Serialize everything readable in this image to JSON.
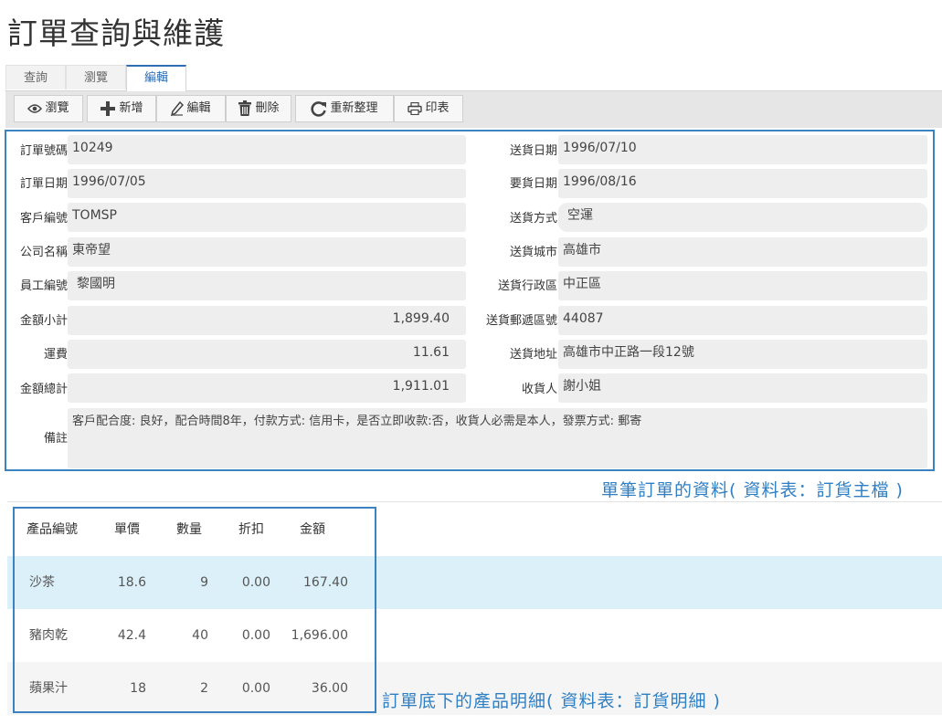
{
  "page_title": "訂單查詢與維護",
  "tabs": [
    {
      "label": "查詢"
    },
    {
      "label": "瀏覽"
    },
    {
      "label": "編輯"
    }
  ],
  "toolbar": {
    "browse": "瀏覽",
    "add": "新增",
    "edit": "編輯",
    "delete": "刪除",
    "refresh": "重新整理",
    "print": "印表"
  },
  "master": {
    "order_no": {
      "label": "訂單號碼",
      "value": "10249"
    },
    "order_date": {
      "label": "訂單日期",
      "value": "1996/07/05"
    },
    "customer_id": {
      "label": "客戶編號",
      "value": "TOMSP"
    },
    "company_name": {
      "label": "公司名稱",
      "value": "東帝望"
    },
    "employee_id": {
      "label": "員工編號",
      "value": "黎國明"
    },
    "subtotal": {
      "label": "金額小計",
      "value": "1,899.40"
    },
    "freight": {
      "label": "運費",
      "value": "11.61"
    },
    "total": {
      "label": "金額總計",
      "value": "1,911.01"
    },
    "ship_date": {
      "label": "送貨日期",
      "value": "1996/07/10"
    },
    "required_date": {
      "label": "要貨日期",
      "value": "1996/08/16"
    },
    "ship_via": {
      "label": "送貨方式",
      "value": "空運"
    },
    "ship_city": {
      "label": "送貨城市",
      "value": "高雄市"
    },
    "ship_region": {
      "label": "送貨行政區",
      "value": "中正區"
    },
    "ship_postal": {
      "label": "送貨郵遞區號",
      "value": "44087"
    },
    "ship_address": {
      "label": "送貨地址",
      "value": "高雄市中正路一段12號"
    },
    "ship_name": {
      "label": "收貨人",
      "value": "謝小姐"
    },
    "notes": {
      "label": "備註",
      "value": "客戶配合度: 良好，配合時間8年，付款方式: 信用卡，是否立即收款:否，收貨人必需是本人，發票方式: 郵寄"
    }
  },
  "master_caption": "單筆訂單的資料( 資料表：訂貨主檔 )",
  "detail": {
    "headers": [
      "產品編號",
      "單價",
      "數量",
      "折扣",
      "金額"
    ],
    "rows": [
      {
        "product": "沙茶",
        "price": "18.6",
        "qty": "9",
        "discount": "0.00",
        "amount": "167.40"
      },
      {
        "product": "豬肉乾",
        "price": "42.4",
        "qty": "40",
        "discount": "0.00",
        "amount": "1,696.00"
      },
      {
        "product": "蘋果汁",
        "price": "18",
        "qty": "2",
        "discount": "0.00",
        "amount": "36.00"
      }
    ]
  },
  "detail_caption": "訂單底下的產品明細( 資料表：訂貨明細 )",
  "colors": {
    "accent": "#2f7fc4",
    "border": "#3b83c0",
    "selected_row": "#dcf0f9"
  }
}
